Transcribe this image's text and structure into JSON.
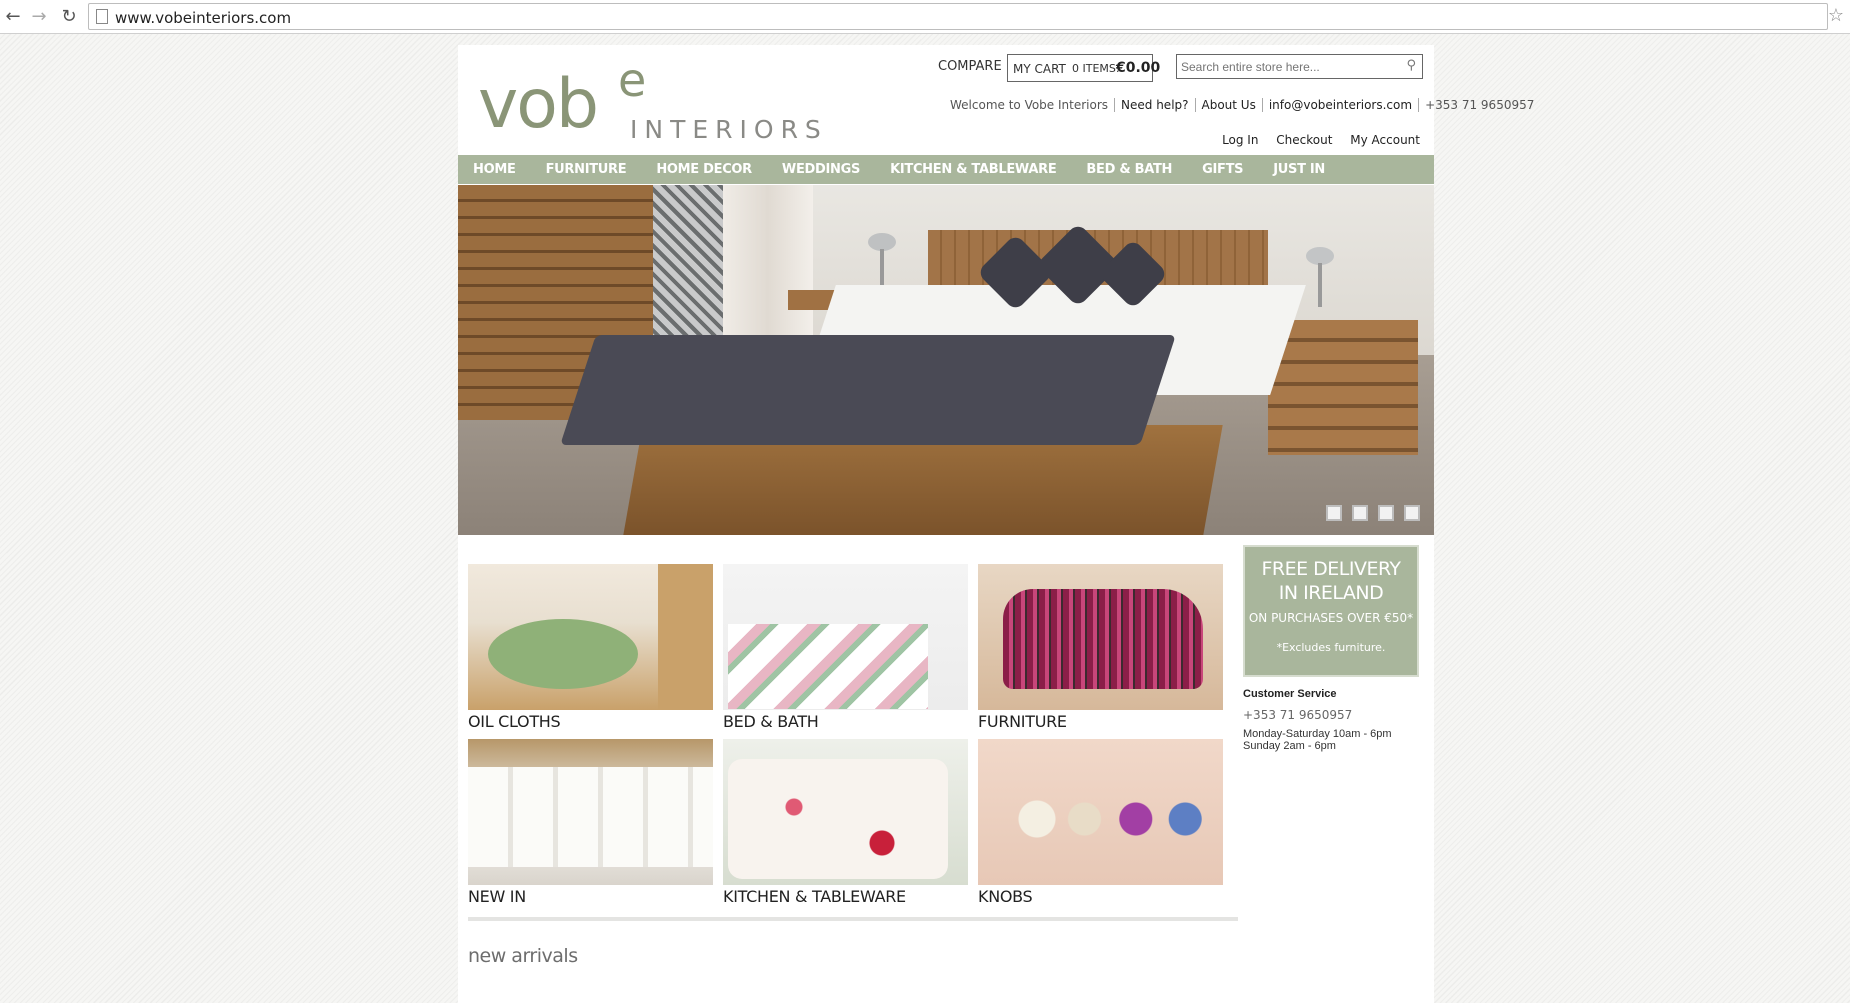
{
  "browser": {
    "url": "www.vobeinteriors.com"
  },
  "header": {
    "logo_main": "vob",
    "logo_e": "e",
    "logo_sub": "INTERIORS",
    "compare": "COMPARE",
    "cart_label": "MY CART",
    "cart_items": "0 ITEMS:",
    "cart_total": "€0.00",
    "search_placeholder": "Search entire store here...",
    "top_links": [
      "Welcome to Vobe Interiors",
      "Need help?",
      "About Us",
      "info@vobeinteriors.com",
      "+353 71 9650957"
    ],
    "account_links": [
      "Log In",
      "Checkout",
      "My Account"
    ]
  },
  "nav": [
    "HOME",
    "FURNITURE",
    "HOME DECOR",
    "WEDDINGS",
    "KITCHEN & TABLEWARE",
    "BED & BATH",
    "GIFTS",
    "JUST IN"
  ],
  "categories": [
    "OIL CLOTHS",
    "BED & BATH",
    "FURNITURE",
    "NEW IN",
    "KITCHEN & TABLEWARE",
    "KNOBS"
  ],
  "promo": {
    "line1": "FREE DELIVERY",
    "line2": "IN IRELAND",
    "line3": "ON PURCHASES OVER €50*",
    "line4": "*Excludes furniture."
  },
  "customer_service": {
    "heading": "Customer Service",
    "phone": "+353 71 9650957",
    "hours1": "Monday-Saturday 10am - 6pm",
    "hours2": "Sunday 2am - 6pm"
  },
  "new_arrivals_heading": "new arrivals",
  "colors": {
    "nav_bg": "#a9b69c",
    "logo": "#8a9577"
  }
}
